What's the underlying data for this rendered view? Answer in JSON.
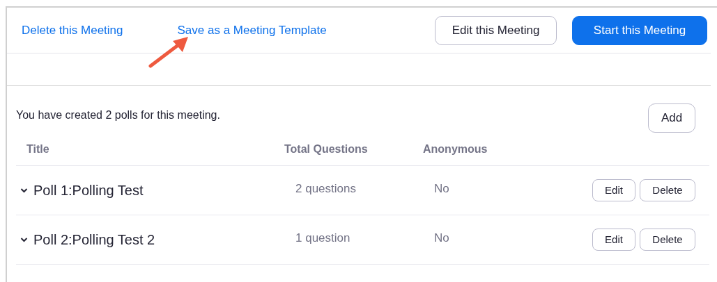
{
  "actions": {
    "links": [
      "Delete this Meeting",
      "Save as a Meeting Template"
    ],
    "buttons": [
      {
        "label": "Edit this Meeting",
        "kind": "secondary"
      },
      {
        "label": "Start this Meeting",
        "kind": "primary"
      }
    ]
  },
  "polls": {
    "summary": "You have created 2 polls for this meeting.",
    "add_button": "Add",
    "columns": [
      "Title",
      "Total Questions",
      "Anonymous"
    ],
    "rows": [
      {
        "title": "Poll 1:Polling Test",
        "questions": "2 questions",
        "anonymous": "No",
        "expanded": false,
        "actions": [
          "Edit",
          "Delete"
        ]
      },
      {
        "title": "Poll 2:Polling Test 2",
        "questions": "1 question",
        "anonymous": "No",
        "expanded": false,
        "actions": [
          "Edit",
          "Delete"
        ]
      }
    ]
  }
}
